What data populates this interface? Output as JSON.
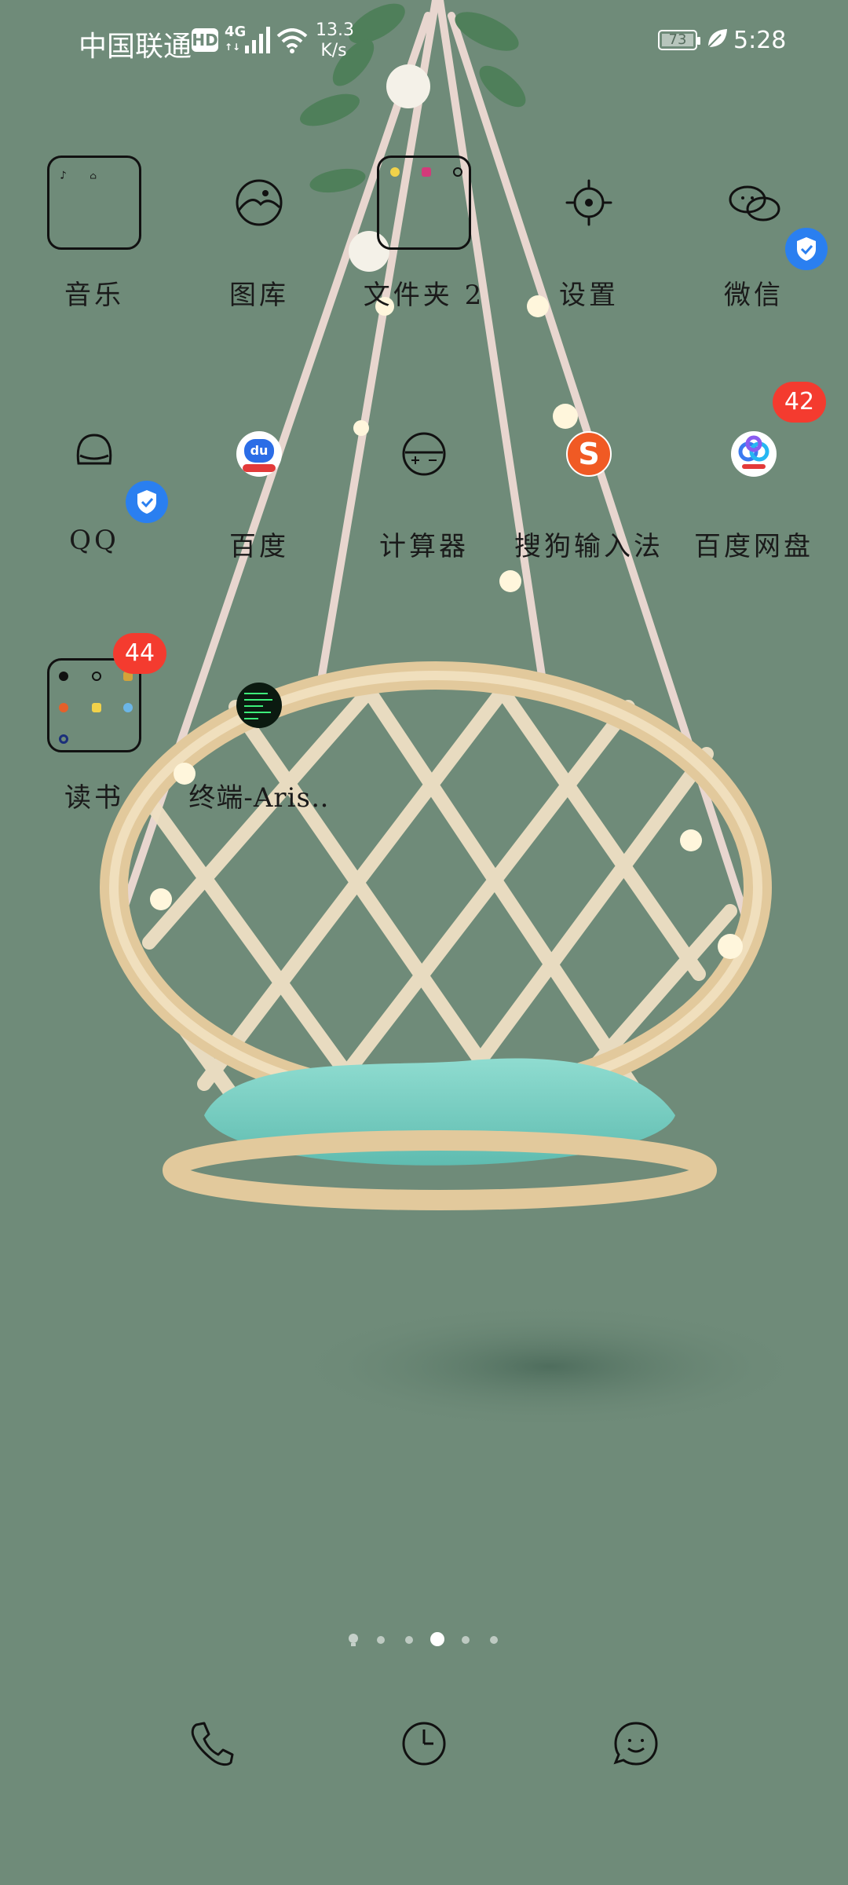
{
  "status_bar": {
    "carrier": "中国联通",
    "hd": "HD",
    "network": "4G",
    "network_sub": "↑↓",
    "speed_value": "13.3",
    "speed_unit": "K/s",
    "battery": "73",
    "time": "5:28"
  },
  "apps": {
    "music": {
      "label": "音乐"
    },
    "gallery": {
      "label": "图库"
    },
    "folder2": {
      "label": "文件夹 2"
    },
    "settings": {
      "label": "设置"
    },
    "wechat": {
      "label": "微信"
    },
    "qq": {
      "label": "QQ"
    },
    "baidu": {
      "label": "百度",
      "logo_text": "du"
    },
    "calculator": {
      "label": "计算器"
    },
    "sogou": {
      "label": "搜狗输入法",
      "logo_text": "S"
    },
    "baidu_netdisk": {
      "label": "百度网盘",
      "badge": "42"
    },
    "reading": {
      "label": "读书",
      "badge": "44"
    },
    "terminal": {
      "label": "终端-Aris‥"
    }
  },
  "page_indicator": {
    "count": 6,
    "active_index": 3
  },
  "dock": [
    "phone-icon",
    "clock-icon",
    "messages-icon"
  ],
  "colors": {
    "background": "#6f8b79",
    "badge": "#f43b2f",
    "security_shield": "#2a7ff0",
    "cushion": "#76cfc3",
    "rattan": "#e6d3b0"
  }
}
